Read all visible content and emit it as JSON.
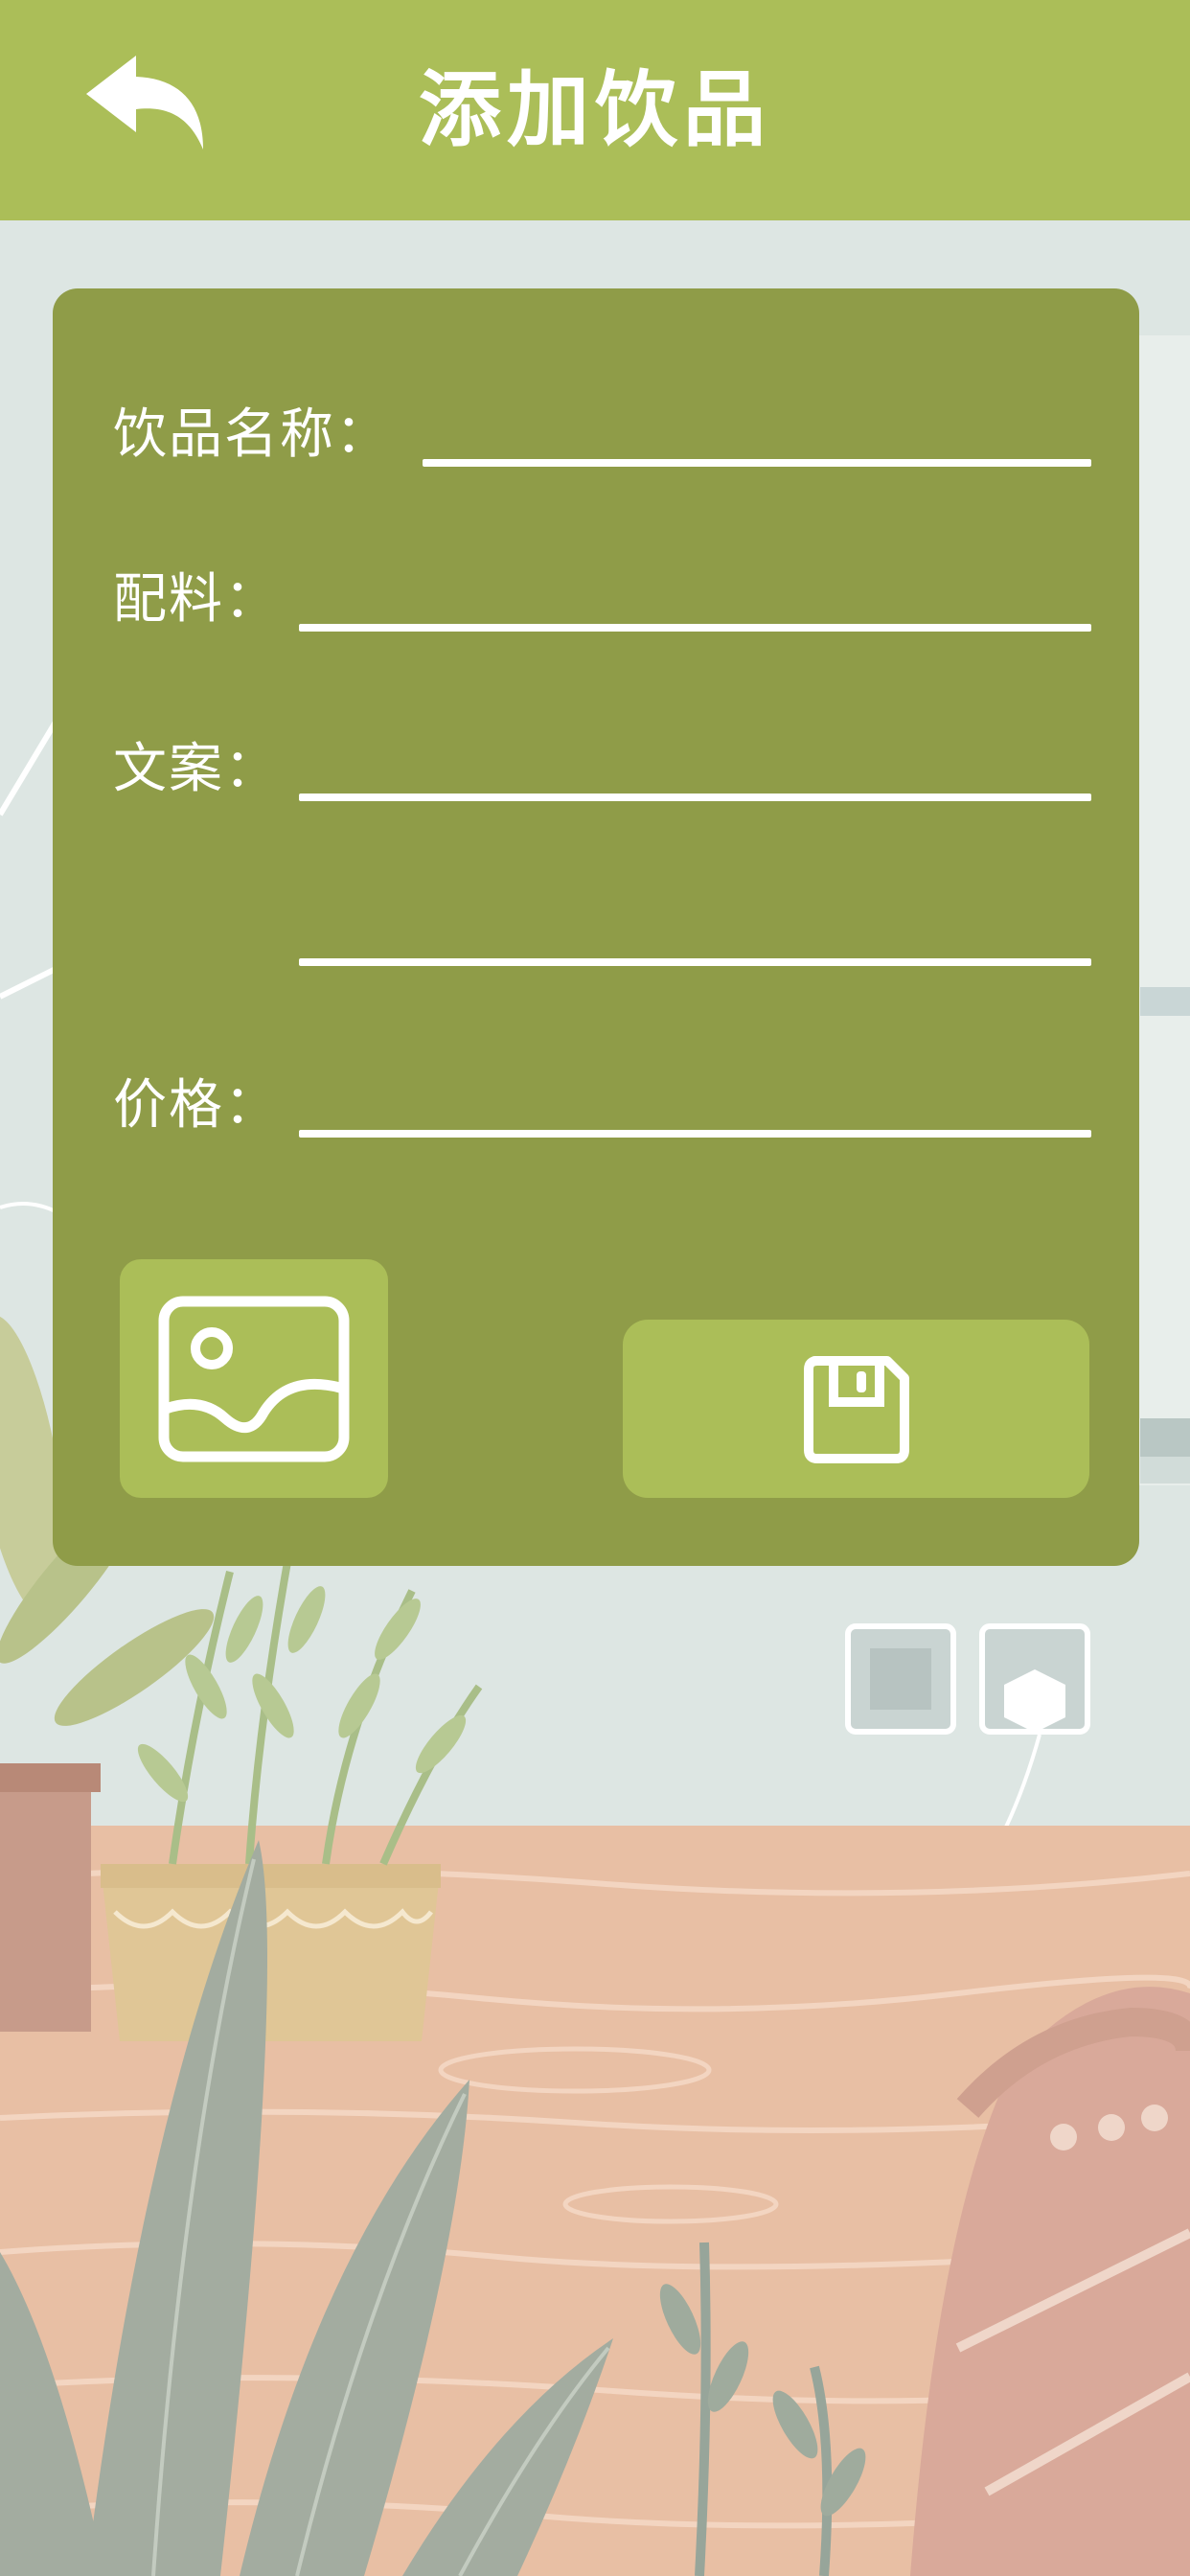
{
  "header": {
    "title": "添加饮品",
    "back_icon": "back-arrow-icon"
  },
  "form": {
    "name_label": "饮品名称：",
    "ingredients_label": "配料：",
    "copy_label": "文案：",
    "price_label": "价格："
  },
  "actions": {
    "image_icon": "image-icon",
    "save_icon": "save-icon"
  },
  "colors": {
    "header": "#abbe58",
    "card": "#8f9c48",
    "button": "#abbe58",
    "text": "#ffffff"
  }
}
